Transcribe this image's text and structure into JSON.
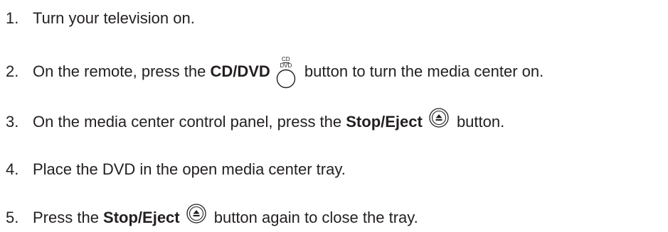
{
  "steps": [
    {
      "number": "1.",
      "text": "Turn your television on."
    },
    {
      "number": "2.",
      "prefix": "On the remote, press the ",
      "bold": "CD/DVD",
      "icon": "cd-dvd-button-icon",
      "icon_label_top": "CD",
      "icon_label_bottom": "DVD",
      "suffix": " button to turn the media center on."
    },
    {
      "number": "3.",
      "prefix": "On the media center control panel, press the ",
      "bold": "Stop/Eject",
      "icon": "stop-eject-icon",
      "suffix": " button."
    },
    {
      "number": "4.",
      "text": "Place the DVD in the open media center tray."
    },
    {
      "number": "5.",
      "prefix": "Press the ",
      "bold": "Stop/Eject",
      "icon": "stop-eject-icon",
      "suffix": " button again to close the tray."
    }
  ]
}
